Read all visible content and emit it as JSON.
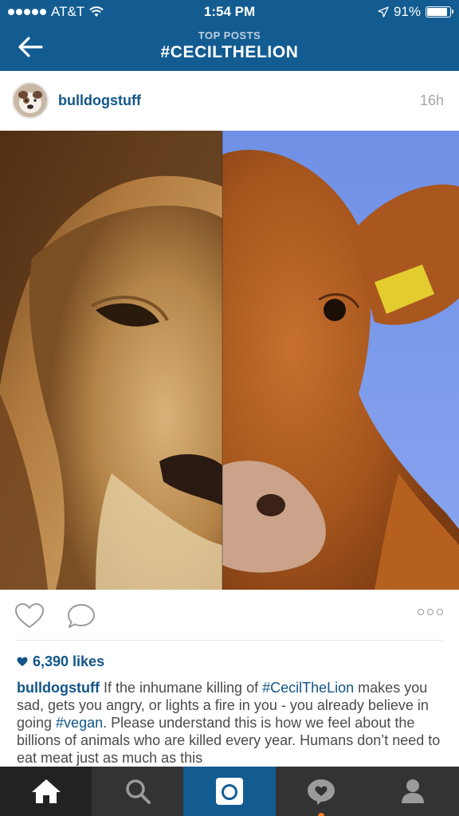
{
  "status_bar": {
    "carrier": "AT&T",
    "time": "1:54 PM",
    "battery": "91%",
    "battery_level": 0.91
  },
  "nav": {
    "subtitle": "TOP POSTS",
    "title": "#CECILTHELION"
  },
  "post": {
    "username": "bulldogstuff",
    "time_ago": "16h",
    "image_description_icons": [
      "lion-half-face",
      "cow-half-face"
    ],
    "likes": "6,390 likes",
    "caption": {
      "username": "bulldogstuff",
      "part1": " If the inhumane killing of ",
      "tag1": "#CecilTheLion",
      "part2": " makes you sad, gets you angry, or lights a fire in you - you already believe in going ",
      "tag2": "#vegan",
      "part3": ". Please understand this is how we feel about the billions of animals who are killed every year. Humans don’t need to eat meat just as much as this"
    }
  },
  "tabbar": {
    "items": [
      "home-icon",
      "search-icon",
      "camera-icon",
      "activity-icon",
      "profile-icon"
    ]
  },
  "colors": {
    "header_blue": "#135c91",
    "link_blue": "#125688",
    "tabbar_dark": "#333334",
    "notification_orange": "#f47a20"
  }
}
